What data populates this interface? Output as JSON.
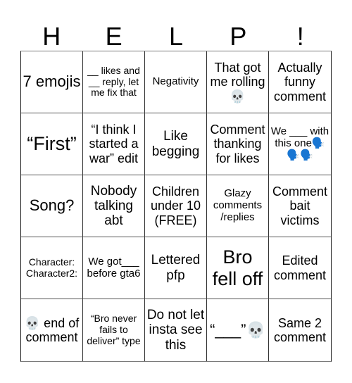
{
  "title": "HELP!",
  "header": {
    "letters": [
      "H",
      "E",
      "L",
      "P",
      "!"
    ]
  },
  "board": {
    "rows": [
      [
        "7 emojis",
        "__ likes and __ reply, let me fix that",
        "Negativity",
        "That got me rolling💀",
        "Actually funny comment"
      ],
      [
        "“First”",
        "“I think I started a war” edit",
        "Like begging",
        "Comment thanking for likes",
        "We ___ with this one🗣️🗣️🗣️"
      ],
      [
        "Song?",
        "Nobody talking abt",
        "Children under 10 (FREE)",
        "Glazy comments /replies",
        "Comment bait victims"
      ],
      [
        "Character: Character2:",
        "We got___ before gta6",
        "Lettered pfp",
        "Bro fell off",
        "Edited comment"
      ],
      [
        "💀 end of comment",
        "“Bro never fails to deliver” type",
        "Do not let insta see this",
        "“___”💀",
        "Same 2 comment"
      ]
    ]
  }
}
